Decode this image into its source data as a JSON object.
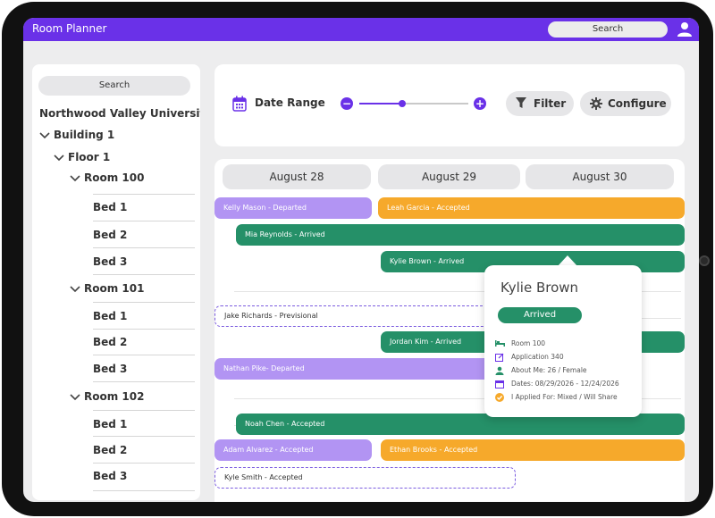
{
  "app": {
    "title": "Room Planner",
    "search_label": "Search",
    "user_icon": "user-icon"
  },
  "sidebar": {
    "search_label": "Search",
    "university": "Northwood Valley University",
    "building": "Building 1",
    "floor": "Floor 1",
    "rooms": [
      {
        "label": "Room 100",
        "beds": [
          "Bed 1",
          "Bed 2",
          "Bed 3"
        ]
      },
      {
        "label": "Room 101",
        "beds": [
          "Bed 1",
          "Bed 2",
          "Bed 3"
        ]
      },
      {
        "label": "Room 102",
        "beds": [
          "Bed 1",
          "Bed 2",
          "Bed 3"
        ]
      }
    ]
  },
  "toolbar": {
    "date_range_label": "Date Range",
    "zoom_minus": "−",
    "zoom_plus": "+",
    "slider_value": 0.39,
    "filter_label": "Filter",
    "configure_label": "Configure"
  },
  "calendar": {
    "days": [
      "August 28",
      "August 29",
      "August 30"
    ],
    "bookings": [
      {
        "label": "Kelly Mason - Departed",
        "color": "purple"
      },
      {
        "label": "Leah Garcia - Accepted",
        "color": "orange"
      },
      {
        "label": "Mia Reynolds - Arrived",
        "color": "green"
      },
      {
        "label": "Kylie  Brown - Arrived",
        "color": "green"
      },
      {
        "label": "Jake Richards - Previsional",
        "color": "dashed"
      },
      {
        "label": "Jordan Kim - Arrived",
        "color": "green"
      },
      {
        "label": "Nathan Pike- Departed",
        "color": "purple"
      },
      {
        "label": "Noah Chen - Accepted",
        "color": "green"
      },
      {
        "label": "Adam Alvarez - Accepted",
        "color": "purple"
      },
      {
        "label": "Ethan Brooks - Accepted",
        "color": "orange"
      },
      {
        "label": "Kyle Smith - Accepted",
        "color": "dashed"
      }
    ]
  },
  "popup": {
    "name": "Kylie Brown",
    "status": "Arrived",
    "details": [
      {
        "icon": "bed-icon",
        "text": "Room 100"
      },
      {
        "icon": "edit-icon",
        "text": "Application 340"
      },
      {
        "icon": "person-icon",
        "text": "About Me: 26 / Female"
      },
      {
        "icon": "calendar-icon",
        "text": "Dates: 08/29/2026 - 12/24/2026"
      },
      {
        "icon": "check-circle-icon",
        "text": "I Applied For: Mixed / Will Share"
      }
    ]
  },
  "colors": {
    "accent": "#6a31e8",
    "green": "#259068",
    "orange": "#f6a92b",
    "purple": "#b294f3"
  }
}
